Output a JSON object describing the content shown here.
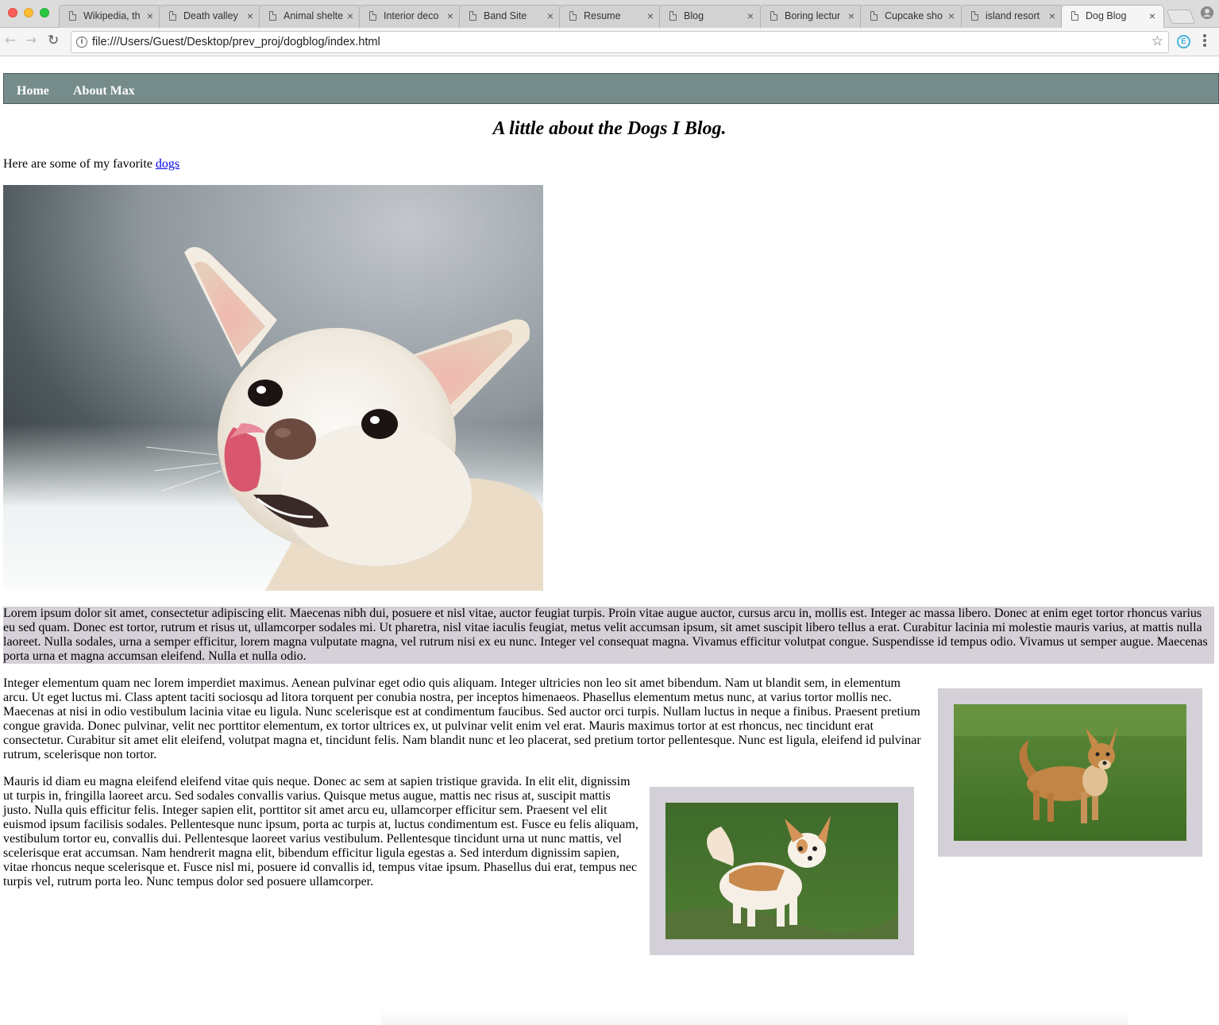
{
  "browser": {
    "tabs": [
      {
        "title": "Wikipedia, th",
        "active": false
      },
      {
        "title": "Death valley",
        "active": false
      },
      {
        "title": "Animal shelte",
        "active": false
      },
      {
        "title": "Interior deco",
        "active": false
      },
      {
        "title": "Band Site",
        "active": false
      },
      {
        "title": "Resume",
        "active": false
      },
      {
        "title": "Blog",
        "active": false
      },
      {
        "title": "Boring lectur",
        "active": false
      },
      {
        "title": "Cupcake sho",
        "active": false
      },
      {
        "title": "island resort",
        "active": false
      },
      {
        "title": "Dog Blog",
        "active": true
      }
    ],
    "close_glyph": "×",
    "url": "file:///Users/Guest/Desktop/prev_proj/dogblog/index.html",
    "icons": {
      "back": "back-arrow-icon",
      "forward": "forward-arrow-icon",
      "reload": "reload-icon",
      "info": "info-icon",
      "star": "bookmark-star-icon",
      "extension": "extension-icon",
      "menu": "menu-icon",
      "profile": "profile-icon"
    }
  },
  "page": {
    "nav": {
      "home": "Home",
      "about": "About Max",
      "background_color": "#768c8b"
    },
    "title": "A little about the Dogs I Blog.",
    "intro_text": "Here are some of my favorite ",
    "intro_link": "dogs",
    "hero_image": "chihuahua-licking-nose",
    "para1": "Lorem ipsum dolor sit amet, consectetur adipiscing elit. Maecenas nibh dui, posuere et nisl vitae, auctor feugiat turpis. Proin vitae augue auctor, cursus arcu in, mollis est. Integer ac massa libero. Donec at enim eget tortor rhoncus varius eu sed quam. Donec est tortor, rutrum et risus ut, ullamcorper sodales mi. Ut pharetra, nisl vitae iaculis feugiat, metus velit accumsan ipsum, sit amet suscipit libero tellus a erat. Curabitur lacinia mi molestie mauris varius, at mattis nulla laoreet. Nulla sodales, urna a semper efficitur, lorem magna vulputate magna, vel rutrum nisi ex eu nunc. Integer vel consequat magna. Vivamus efficitur volutpat congue. Suspendisse id tempus odio. Vivamus ut semper augue. Maecenas porta urna et magna accumsan eleifend. Nulla et nulla odio.",
    "para1_bg": "#d6d0d9",
    "para2": "Integer elementum quam nec lorem imperdiet maximus. Aenean pulvinar eget odio quis aliquam. Integer ultricies non leo sit amet bibendum. Nam ut blandit sem, in elementum arcu. Ut eget luctus mi. Class aptent taciti sociosqu ad litora torquent per conubia nostra, per inceptos himenaeos. Phasellus elementum metus nunc, at varius tortor mollis nec. Maecenas at nisi in odio vestibulum lacinia vitae eu ligula. Nunc scelerisque est at condimentum faucibus. Sed auctor orci turpis. Nullam luctus in neque a finibus. Praesent pretium congue gravida. Donec pulvinar, velit nec porttitor elementum, ex tortor ultrices ex, ut pulvinar velit enim vel erat. Mauris maximus tortor at est rhoncus, nec tincidunt erat consectetur. Curabitur sit amet elit eleifend, volutpat magna et, tincidunt felis. Nam blandit nunc et leo placerat, sed pretium tortor pellentesque. Nunc est ligula, eleifend id pulvinar rutrum, scelerisque non tortor.",
    "para3": "Mauris id diam eu magna eleifend eleifend vitae quis neque. Donec ac sem at sapien tristique gravida. In elit elit, dignissim ut turpis in, fringilla laoreet arcu. Sed sodales convallis varius. Quisque metus augue, mattis nec risus at, suscipit mattis justo. Nulla quis efficitur felis. Integer sapien elit, porttitor sit amet arcu eu, ullamcorper efficitur sem. Praesent vel elit euismod ipsum facilisis sodales. Pellentesque nunc ipsum, porta ac turpis at, luctus condimentum est. Fusce eu felis aliquam, vestibulum tortor eu, convallis dui. Pellentesque laoreet varius vestibulum. Pellentesque tincidunt urna ut nunc mattis, vel scelerisque erat accumsan. Nam hendrerit magna elit, bibendum efficitur ligula egestas a. Sed interdum dignissim sapien, vitae rhoncus neque scelerisque et. Fusce nisl mi, posuere id convallis id, tempus vitae ipsum. Phasellus dui erat, tempus nec turpis vel, rutrum porta leo. Nunc tempus dolor sed posuere ullamcorper.",
    "photo1": "chihuahua-on-grass-tan",
    "photo2": "chihuahua-on-grass-longhair",
    "frame_bg": "#d4d0d7"
  }
}
